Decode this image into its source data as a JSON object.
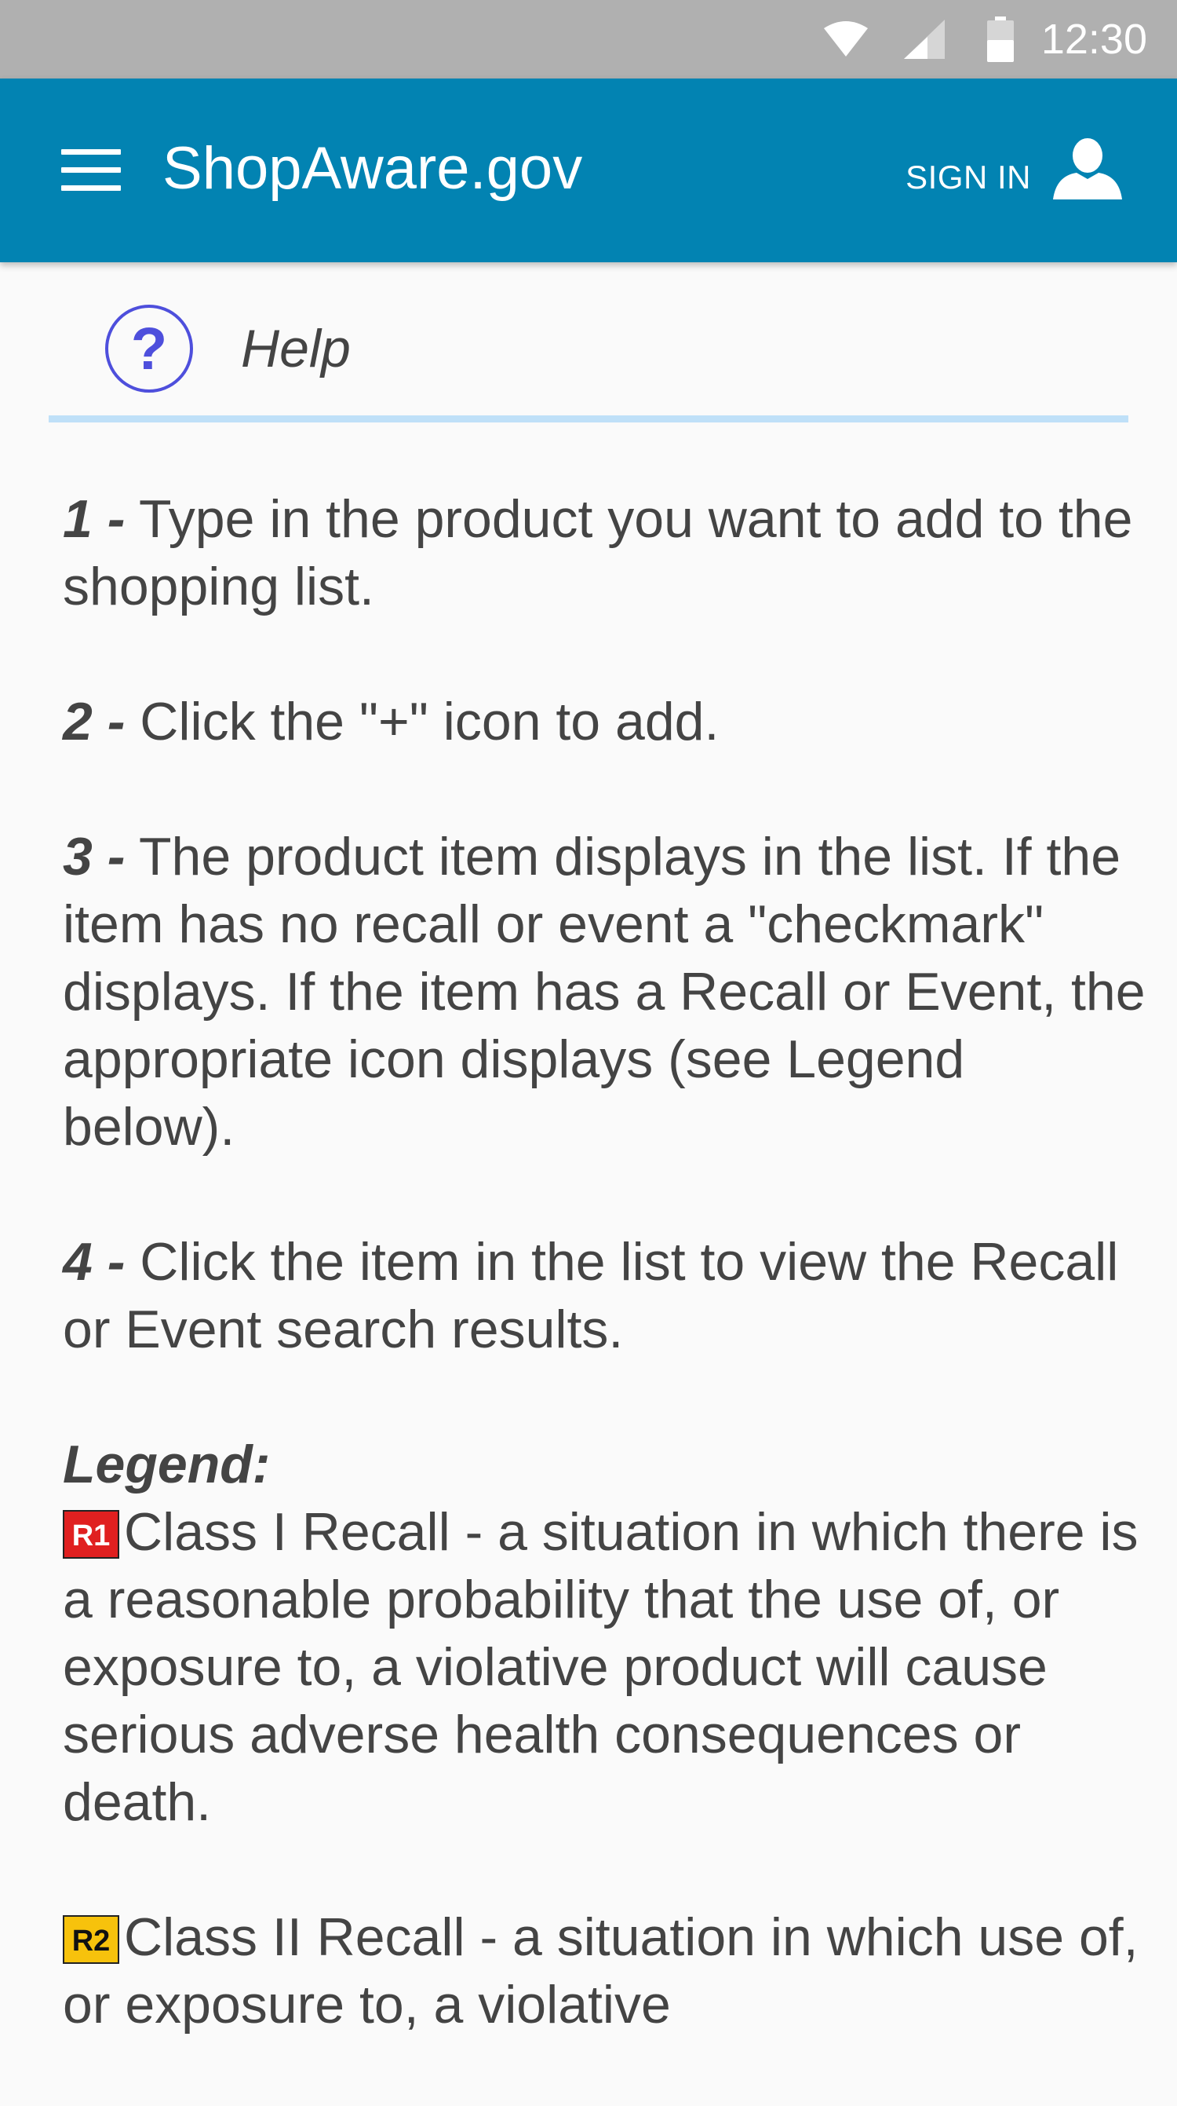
{
  "status_bar": {
    "time": "12:30",
    "icons": [
      "wifi-icon",
      "signal-icon",
      "battery-icon"
    ]
  },
  "app_bar": {
    "title": "ShopAware.gov",
    "sign_in_label": "SIGN IN",
    "color": "#0283b2"
  },
  "help": {
    "title": "Help",
    "icon_glyph": "?"
  },
  "steps": [
    {
      "num": "1 -",
      "text": " Type in the product you want to add to the shopping list."
    },
    {
      "num": "2 -",
      "text": " Click the \"+\" icon to add."
    },
    {
      "num": "3 -",
      "text": " The product item displays in the list. If the item has no recall or event a \"checkmark\" displays. If the item has a Recall or Event, the appropriate icon displays (see Legend below)."
    },
    {
      "num": "4 -",
      "text": " Click the item in the list to view the Recall or Event search results."
    }
  ],
  "legend": {
    "title": "Legend:",
    "items": [
      {
        "badge": "R1",
        "badge_color": "#e02020",
        "text": "Class I Recall - a situation in which there is a reasonable probability that the use of, or exposure to, a violative product will cause serious adverse health consequences or death."
      },
      {
        "badge": "R2",
        "badge_color": "#f7c20c",
        "text": "Class II Recall - a situation in which use of, or exposure to, a violative"
      }
    ]
  }
}
